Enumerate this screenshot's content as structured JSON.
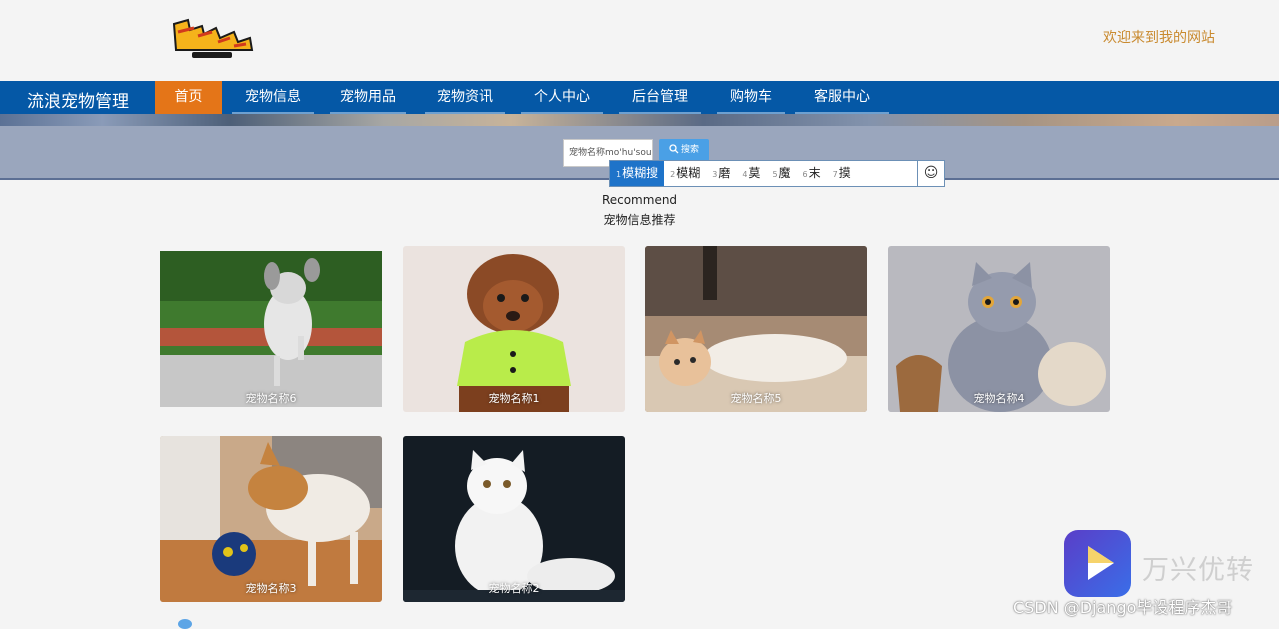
{
  "header": {
    "logo_name": "digimon-logo",
    "welcome": "欢迎来到我的网站"
  },
  "nav": {
    "brand": "流浪宠物管理",
    "items": [
      "首页",
      "宠物信息",
      "宠物用品",
      "宠物资讯",
      "个人中心",
      "后台管理",
      "购物车",
      "客服中心"
    ],
    "active": "首页"
  },
  "search": {
    "value": "宠物名称mo'hu'sou",
    "button_label": "搜索",
    "icon": "search-icon"
  },
  "ime": {
    "candidates": [
      {
        "n": "1",
        "text": "模糊搜"
      },
      {
        "n": "2",
        "text": "模糊"
      },
      {
        "n": "3",
        "text": "磨"
      },
      {
        "n": "4",
        "text": "莫"
      },
      {
        "n": "5",
        "text": "魔"
      },
      {
        "n": "6",
        "text": "末"
      },
      {
        "n": "7",
        "text": "摸"
      }
    ],
    "emoji": "☺"
  },
  "recommend": {
    "en": "Recommend",
    "cn": "宠物信息推荐"
  },
  "pets": [
    {
      "name": "宠物名称6",
      "kind": "dog"
    },
    {
      "name": "宠物名称1",
      "kind": "poodle"
    },
    {
      "name": "宠物名称5",
      "kind": "cat"
    },
    {
      "name": "宠物名称4",
      "kind": "grey-cat"
    },
    {
      "name": "宠物名称3",
      "kind": "shiba"
    },
    {
      "name": "宠物名称2",
      "kind": "white-cat"
    }
  ],
  "watermark": {
    "brand": "万兴优转",
    "csdn": "CSDN @Django毕设程序杰哥"
  },
  "colors": {
    "nav_bg": "#0558a6",
    "nav_active": "#e47518",
    "welcome": "#c98a2f"
  }
}
